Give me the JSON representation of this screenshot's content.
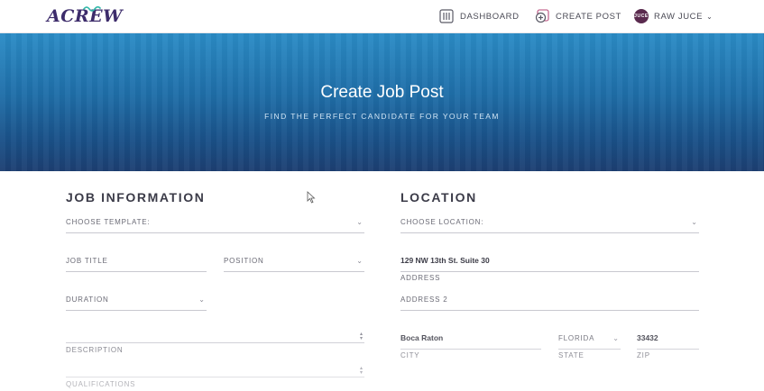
{
  "app": {
    "logo_text": "ACREW"
  },
  "nav": {
    "dashboard": "DASHBOARD",
    "create_post": "CREATE POST",
    "user": "RAW JUCE",
    "avatar_text": "JUCE"
  },
  "hero": {
    "title": "Create Job Post",
    "subtitle": "FIND THE PERFECT CANDIDATE FOR YOUR TEAM"
  },
  "job_information": {
    "title": "JOB INFORMATION",
    "choose_template": "CHOOSE TEMPLATE:",
    "job_title": "JOB TITLE",
    "position": "POSITION",
    "duration": "DURATION",
    "description": "DESCRIPTION",
    "qualifications": "QUALIFICATIONS"
  },
  "location": {
    "title": "LOCATION",
    "choose_location": "CHOOSE LOCATION:",
    "address_value": "129 NW 13th St. Suite 30",
    "address_label": "ADDRESS",
    "address2": "ADDRESS 2",
    "city_value": "Boca Raton",
    "city_label": "CITY",
    "state_value": "FLORIDA",
    "state_label": "STATE",
    "zip_value": "33432",
    "zip_label": "ZIP"
  },
  "colors": {
    "brand": "#3d2c6b",
    "hero_top": "#2b8cc6",
    "hero_bottom": "#1d3f72"
  }
}
